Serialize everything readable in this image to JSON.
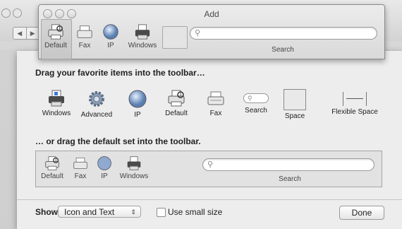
{
  "window": {
    "title": "Add"
  },
  "background_window": {
    "nav_back": "◀",
    "nav_forward": "▶"
  },
  "preview_toolbar": {
    "items": [
      {
        "label": "Default",
        "icon": "printer-default-icon"
      },
      {
        "label": "Fax",
        "icon": "fax-icon"
      },
      {
        "label": "IP",
        "icon": "globe-icon"
      },
      {
        "label": "Windows",
        "icon": "printer-windows-icon"
      }
    ],
    "search_label": "Search",
    "search_placeholder": "",
    "search_icon": "magnifier-icon"
  },
  "palette": {
    "heading": "Drag your favorite items into the toolbar…",
    "items": [
      {
        "label": "Windows",
        "icon": "printer-windows-icon"
      },
      {
        "label": "Advanced",
        "icon": "gear-icon"
      },
      {
        "label": "IP",
        "icon": "globe-icon"
      },
      {
        "label": "Default",
        "icon": "printer-default-icon"
      },
      {
        "label": "Fax",
        "icon": "fax-icon"
      },
      {
        "label": "Search",
        "icon": "search-field-icon"
      },
      {
        "label": "Space",
        "icon": "space-icon"
      },
      {
        "label": "Flexible Space",
        "icon": "flexible-space-icon"
      }
    ]
  },
  "default_set": {
    "heading": "… or drag the default set into the toolbar.",
    "items": [
      {
        "label": "Default"
      },
      {
        "label": "Fax"
      },
      {
        "label": "IP"
      },
      {
        "label": "Windows"
      }
    ],
    "search_label": "Search"
  },
  "bottom": {
    "show_label": "Show",
    "show_value": "Icon and Text",
    "popup_arrows": "⇕",
    "small_size_label": "Use small size",
    "small_size_checked": false,
    "done_label": "Done"
  }
}
